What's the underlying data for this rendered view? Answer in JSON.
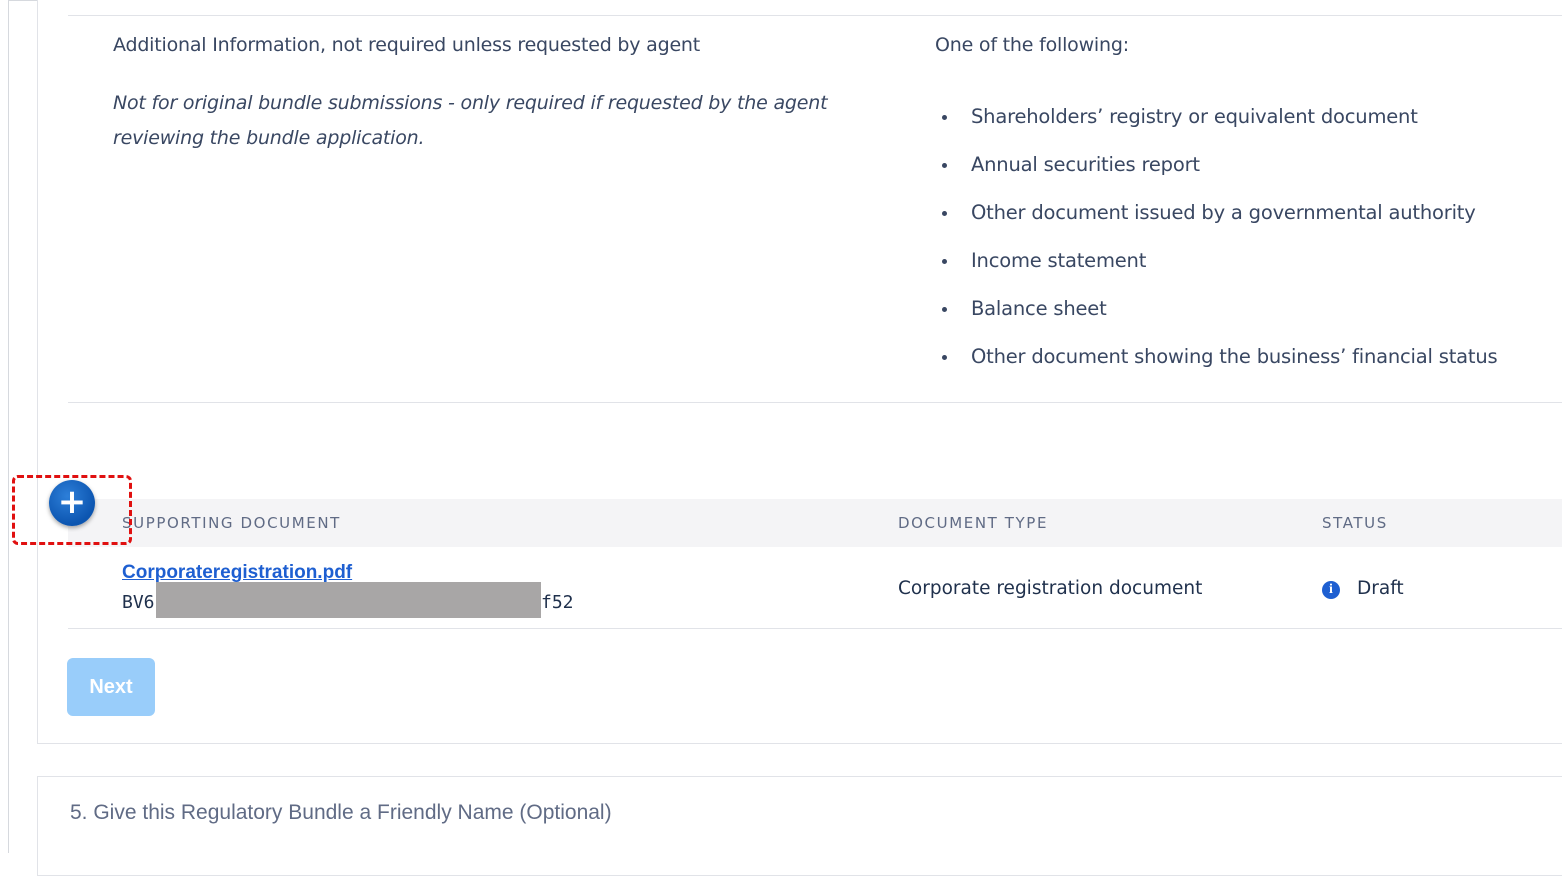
{
  "requirement": {
    "title": "Additional Information, not required unless requested by agent",
    "note": "Not for original bundle submissions - only required if requested by the agent reviewing the bundle application.",
    "options_title": "One of the following:",
    "options": [
      "Shareholders’ registry or equivalent document",
      "Annual securities report",
      "Other document issued by a governmental authority",
      "Income statement",
      "Balance sheet",
      "Other document showing the business’ financial status"
    ]
  },
  "table": {
    "headers": {
      "document": "SUPPORTING DOCUMENT",
      "type": "DOCUMENT TYPE",
      "status": "STATUS"
    },
    "rows": [
      {
        "file_name": "Corporateregistration.pdf",
        "sid_start": "BV6",
        "sid_end": "f52",
        "document_type": "Corporate registration document",
        "status": "Draft",
        "status_icon": "info-icon",
        "status_icon_glyph": "i"
      }
    ]
  },
  "add_button": {
    "label": "+",
    "icon": "plus-icon"
  },
  "next_button": {
    "label": "Next",
    "disabled": true
  },
  "step5": {
    "title": "5. Give this Regulatory Bundle a Friendly Name (Optional)"
  },
  "colors": {
    "link": "#1e5fd1",
    "add_button": "#1565c0",
    "next_disabled": "#99cdfa",
    "highlight": "#e01010",
    "redaction": "#a8a6a6"
  }
}
